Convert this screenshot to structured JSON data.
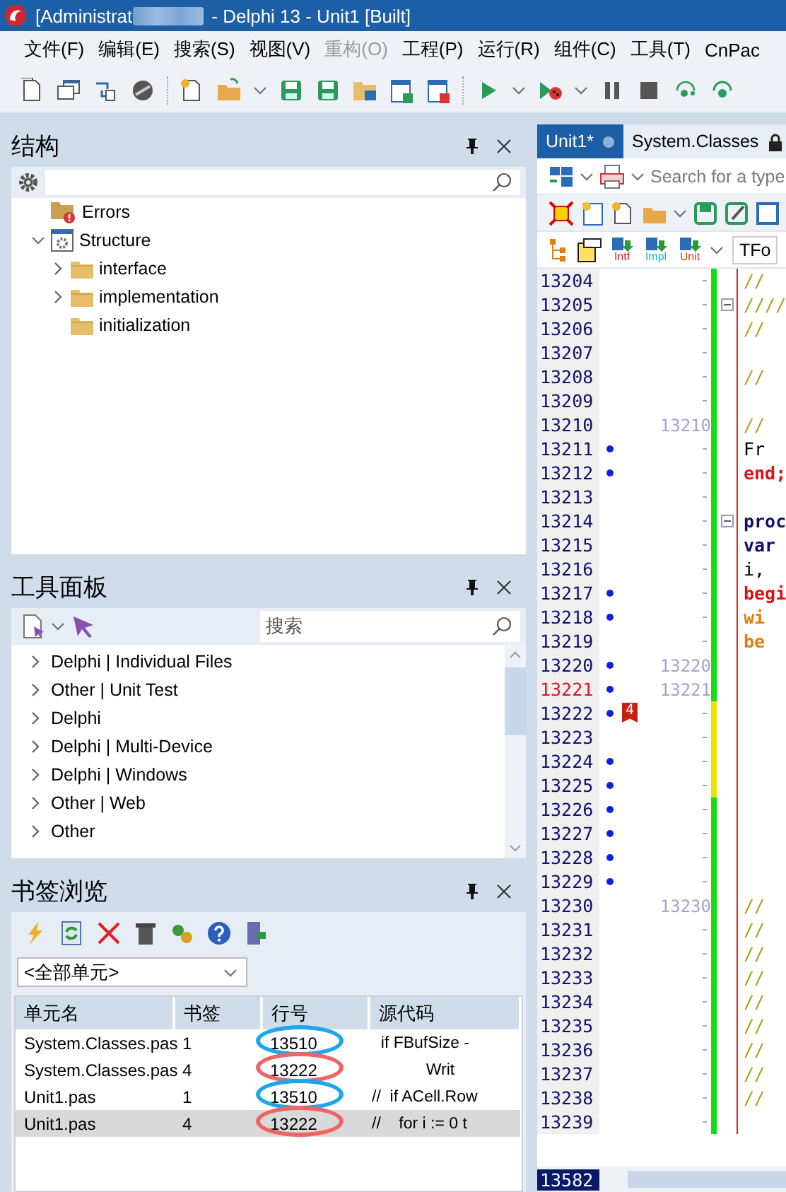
{
  "window": {
    "title_prefix": "[Administrat",
    "title": "- Delphi 13 - Unit1 [Built]"
  },
  "menu": [
    {
      "label": "文件(F)",
      "disabled": false
    },
    {
      "label": "编辑(E)",
      "disabled": false
    },
    {
      "label": "搜索(S)",
      "disabled": false
    },
    {
      "label": "视图(V)",
      "disabled": false
    },
    {
      "label": "重构(O)",
      "disabled": true
    },
    {
      "label": "工程(P)",
      "disabled": false
    },
    {
      "label": "运行(R)",
      "disabled": false
    },
    {
      "label": "组件(C)",
      "disabled": false
    },
    {
      "label": "工具(T)",
      "disabled": false
    },
    {
      "label": "CnPac",
      "disabled": false
    }
  ],
  "structure": {
    "title": "结构",
    "tree": [
      {
        "label": "Errors",
        "kind": "errors"
      },
      {
        "label": "Structure",
        "kind": "unit",
        "expanded": true,
        "children": [
          {
            "label": "interface",
            "kind": "folder",
            "expanded": false
          },
          {
            "label": "implementation",
            "kind": "folder",
            "expanded": false
          },
          {
            "label": "initialization",
            "kind": "folder"
          }
        ]
      }
    ]
  },
  "palette": {
    "title": "工具面板",
    "search": {
      "placeholder": "搜索"
    },
    "items": [
      {
        "label": "Delphi | Individual Files",
        "expanded": false
      },
      {
        "label": "Other | Unit Test",
        "expanded": false
      },
      {
        "label": "Delphi",
        "expanded": false
      },
      {
        "label": "Delphi | Multi-Device",
        "expanded": false
      },
      {
        "label": "Delphi | Windows",
        "expanded": false
      },
      {
        "label": "Other | Web",
        "expanded": false
      },
      {
        "label": "Other",
        "expanded": false
      }
    ]
  },
  "bookmarks": {
    "title": "书签浏览",
    "unit_filter": "<全部单元>",
    "columns": [
      "单元名",
      "书签",
      "行号",
      "源代码"
    ],
    "rows": [
      {
        "cells": [
          "System.Classes.pas",
          "1",
          "13510",
          "  if FBufSize -"
        ],
        "selected": false,
        "color": "#1ea6ea"
      },
      {
        "cells": [
          "System.Classes.pas",
          "4",
          "13222",
          "            Writ"
        ],
        "selected": false,
        "color": "#f06464"
      },
      {
        "cells": [
          "Unit1.pas",
          "1",
          "13510",
          "//  if ACell.Row"
        ],
        "selected": false,
        "color": "#1ea6ea"
      },
      {
        "cells": [
          "Unit1.pas",
          "4",
          "13222",
          "//    for i := 0 t"
        ],
        "selected": true,
        "color": "#f06464"
      }
    ]
  },
  "editor": {
    "tabs": [
      {
        "label": "Unit1*",
        "selected": true,
        "modified": true,
        "locked": false
      },
      {
        "label": "System.Classes",
        "selected": false,
        "modified": false,
        "locked": true
      }
    ],
    "search": {
      "placeholder": "Search for a type"
    },
    "class_combo": "TFo",
    "toolbar_labels": [
      "Intf",
      "Impl",
      "Unit"
    ],
    "lines": [
      {
        "n": "13204",
        "dot": false,
        "current": false,
        "unsaved": false,
        "fold": false,
        "code": "//",
        "kind": "comment"
      },
      {
        "n": "13205",
        "dot": false,
        "current": false,
        "unsaved": false,
        "fold": true,
        "code": "////",
        "kind": "comment"
      },
      {
        "n": "13206",
        "dot": false,
        "current": false,
        "unsaved": false,
        "fold": false,
        "code": "//",
        "kind": "comment"
      },
      {
        "n": "13207",
        "dot": false,
        "current": false,
        "unsaved": false,
        "fold": false
      },
      {
        "n": "13208",
        "dot": false,
        "current": false,
        "unsaved": false,
        "fold": false,
        "code": "//",
        "kind": "comment"
      },
      {
        "n": "13209",
        "dot": false,
        "current": false,
        "unsaved": false,
        "fold": false
      },
      {
        "n": "13210",
        "dot": false,
        "current": false,
        "unsaved": false,
        "fold": false,
        "ref": "13210",
        "code": "//",
        "kind": "comment"
      },
      {
        "n": "13211",
        "dot": true,
        "current": false,
        "unsaved": false,
        "fold": false,
        "code": "Fr",
        "kind": "plain"
      },
      {
        "n": "13212",
        "dot": true,
        "current": false,
        "unsaved": false,
        "fold": false,
        "code": "end;",
        "kind": "block"
      },
      {
        "n": "13213",
        "dot": false,
        "current": false,
        "unsaved": false,
        "fold": false
      },
      {
        "n": "13214",
        "dot": false,
        "current": false,
        "unsaved": false,
        "fold": true,
        "code": "proc",
        "kind": "keyword"
      },
      {
        "n": "13215",
        "dot": false,
        "current": false,
        "unsaved": false,
        "fold": false,
        "code": "var",
        "kind": "keyword"
      },
      {
        "n": "13216",
        "dot": false,
        "current": false,
        "unsaved": false,
        "fold": false,
        "code": "i,",
        "kind": "plain"
      },
      {
        "n": "13217",
        "dot": true,
        "current": false,
        "unsaved": false,
        "fold": false,
        "code": "begi",
        "kind": "block"
      },
      {
        "n": "13218",
        "dot": true,
        "current": false,
        "unsaved": false,
        "fold": false,
        "code": "wi",
        "kind": "loop"
      },
      {
        "n": "13219",
        "dot": false,
        "current": false,
        "unsaved": false,
        "fold": false,
        "code": "be",
        "kind": "loop"
      },
      {
        "n": "13220",
        "dot": true,
        "current": false,
        "unsaved": false,
        "fold": false,
        "ref": "13220"
      },
      {
        "n": "13221",
        "dot": true,
        "current": true,
        "unsaved": false,
        "fold": false,
        "ref": "13221"
      },
      {
        "n": "13222",
        "dot": true,
        "current": false,
        "unsaved": true,
        "fold": false,
        "bookmark": "4"
      },
      {
        "n": "13223",
        "dot": false,
        "current": false,
        "unsaved": true,
        "fold": false
      },
      {
        "n": "13224",
        "dot": true,
        "current": false,
        "unsaved": true,
        "fold": false
      },
      {
        "n": "13225",
        "dot": true,
        "current": false,
        "unsaved": true,
        "fold": false
      },
      {
        "n": "13226",
        "dot": true,
        "current": false,
        "unsaved": false,
        "fold": false
      },
      {
        "n": "13227",
        "dot": true,
        "current": false,
        "unsaved": false,
        "fold": false
      },
      {
        "n": "13228",
        "dot": true,
        "current": false,
        "unsaved": false,
        "fold": false
      },
      {
        "n": "13229",
        "dot": true,
        "current": false,
        "unsaved": false,
        "fold": false
      },
      {
        "n": "13230",
        "dot": false,
        "current": false,
        "unsaved": false,
        "fold": false,
        "ref": "13230",
        "code": "//",
        "kind": "comment"
      },
      {
        "n": "13231",
        "dot": false,
        "current": false,
        "unsaved": false,
        "fold": false,
        "code": "//",
        "kind": "comment"
      },
      {
        "n": "13232",
        "dot": false,
        "current": false,
        "unsaved": false,
        "fold": false,
        "code": "//",
        "kind": "comment"
      },
      {
        "n": "13233",
        "dot": false,
        "current": false,
        "unsaved": false,
        "fold": false,
        "code": "//",
        "kind": "comment"
      },
      {
        "n": "13234",
        "dot": false,
        "current": false,
        "unsaved": false,
        "fold": false,
        "code": "//",
        "kind": "comment"
      },
      {
        "n": "13235",
        "dot": false,
        "current": false,
        "unsaved": false,
        "fold": false,
        "code": "//",
        "kind": "comment"
      },
      {
        "n": "13236",
        "dot": false,
        "current": false,
        "unsaved": false,
        "fold": false,
        "code": "//",
        "kind": "comment"
      },
      {
        "n": "13237",
        "dot": false,
        "current": false,
        "unsaved": false,
        "fold": false,
        "code": "//",
        "kind": "comment"
      },
      {
        "n": "13238",
        "dot": false,
        "current": false,
        "unsaved": false,
        "fold": false,
        "code": "//",
        "kind": "comment"
      },
      {
        "n": "13239",
        "dot": false,
        "current": false,
        "unsaved": false,
        "fold": false
      }
    ],
    "line_count": "13582"
  }
}
